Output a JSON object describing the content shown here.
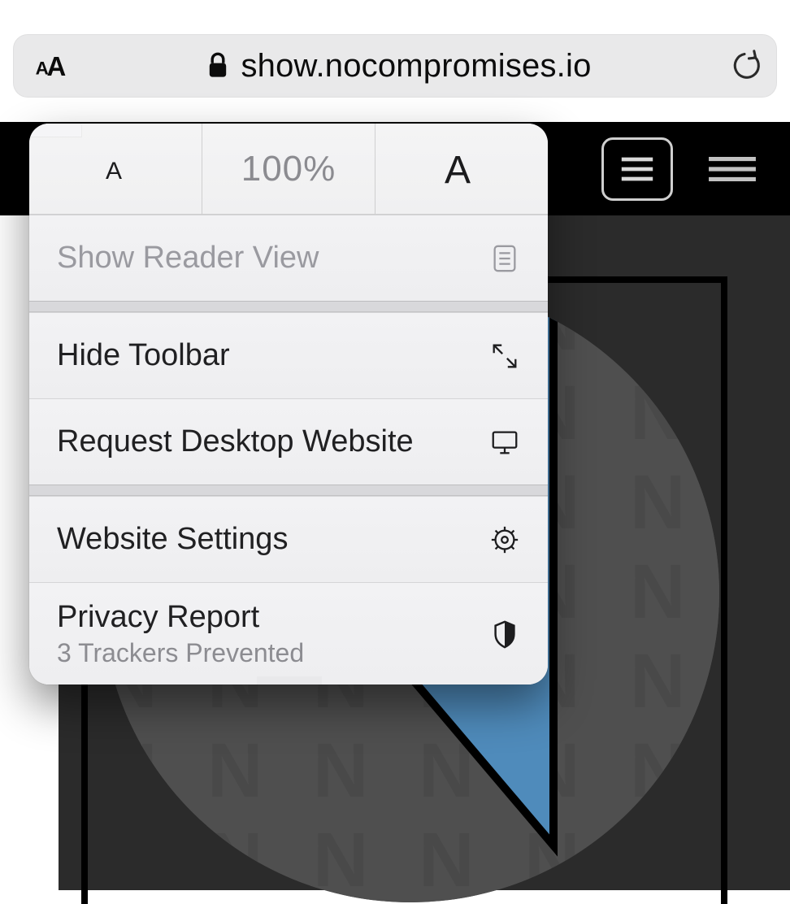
{
  "addressbar": {
    "url": "show.nocompromises.io"
  },
  "zoom": {
    "percent_label": "100%"
  },
  "menu": {
    "reader": {
      "label": "Show Reader View"
    },
    "toolbar": {
      "label": "Hide Toolbar"
    },
    "desktop": {
      "label": "Request Desktop Website"
    },
    "settings": {
      "label": "Website Settings"
    },
    "privacy": {
      "label": "Privacy Report",
      "subtitle": "3 Trackers Prevented"
    }
  },
  "colors": {
    "accent_blue": "#4f8bbb"
  }
}
